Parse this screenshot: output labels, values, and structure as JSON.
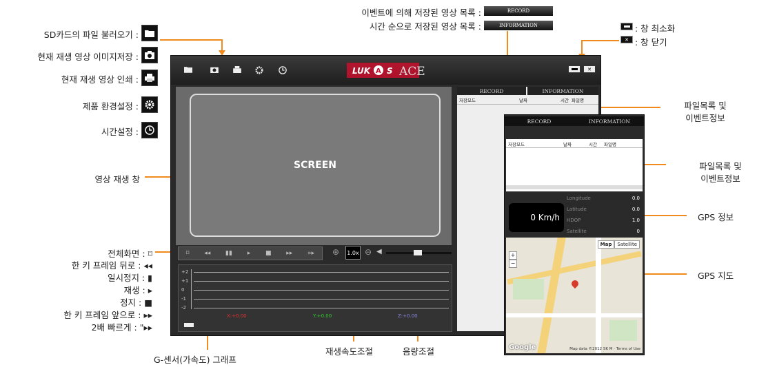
{
  "left_labels": [
    {
      "text": "SD카드의 파일 불러오기 :",
      "icon": "folder-icon"
    },
    {
      "text": "현재 재생 영상 이미지저장 :",
      "icon": "camera-icon"
    },
    {
      "text": "현재 재생 영상 인쇄 :",
      "icon": "print-icon"
    },
    {
      "text": "제품 환경설정 :",
      "icon": "gear-icon"
    },
    {
      "text": "시간설정 :",
      "icon": "clock-icon"
    }
  ],
  "screen_label": "영상 재생 창",
  "control_labels": [
    "전체화면 : ⌑",
    "한 키 프레임 뒤로 : ◂◂",
    "일시정지 : ▮",
    "재생 : ▸",
    "정지 : ■",
    "한 키 프레임 앞으로 : ▸▸",
    "2배 빠르게 : \"▸▸"
  ],
  "top_labels": {
    "record_text": "이벤트에 의해 저장된 영상 목록 :",
    "record_btn": "RECORD",
    "info_text": "시간 순으로 저장된 영상 목록 :",
    "info_btn": "INFORMATION"
  },
  "window_labels": {
    "minimize": ": 창 최소화",
    "close": ": 창 닫기"
  },
  "right_labels": {
    "file_list_1": "파일목록 및\n이벤트정보",
    "file_list_2": "파일목록 및\n이벤트정보",
    "gps_info": "GPS 정보",
    "gps_map": "GPS 지도"
  },
  "bottom_labels": {
    "gsensor": "G-센서(가속도) 그래프",
    "speed": "재생속도조절",
    "volume": "음량조절"
  },
  "app": {
    "logo": "LUKAS ACE",
    "screen_text": "SCREEN",
    "speed_value": "1.0x",
    "tabs": [
      "RECORD",
      "INFORMATION"
    ],
    "columns": [
      "저장모드",
      "날짜",
      "시간",
      "파일명"
    ],
    "graph_axis": [
      "+2",
      "+1",
      "0",
      "-1",
      "-2"
    ],
    "graph_readouts": [
      "X:+0.00",
      "Y:+0.00",
      "Z:+0.00"
    ]
  },
  "overlay": {
    "tabs": [
      "RECORD",
      "INFORMATION"
    ],
    "columns": [
      "저장모드",
      "날짜",
      "시간",
      "파일명"
    ],
    "speed": "0 Km/h",
    "gps": [
      {
        "key": "Longitude",
        "value": "0.0"
      },
      {
        "key": "Latitude",
        "value": "0.0"
      },
      {
        "key": "HDOP",
        "value": "1.0"
      },
      {
        "key": "Satellite",
        "value": "0"
      }
    ],
    "map_buttons": [
      "Map",
      "Satellite"
    ],
    "google": "Google",
    "copyright": "Map data ©2012 SK M · Terms of Use"
  },
  "colors": {
    "accent": "#f08a1c",
    "logo_red": "#c8102e"
  }
}
